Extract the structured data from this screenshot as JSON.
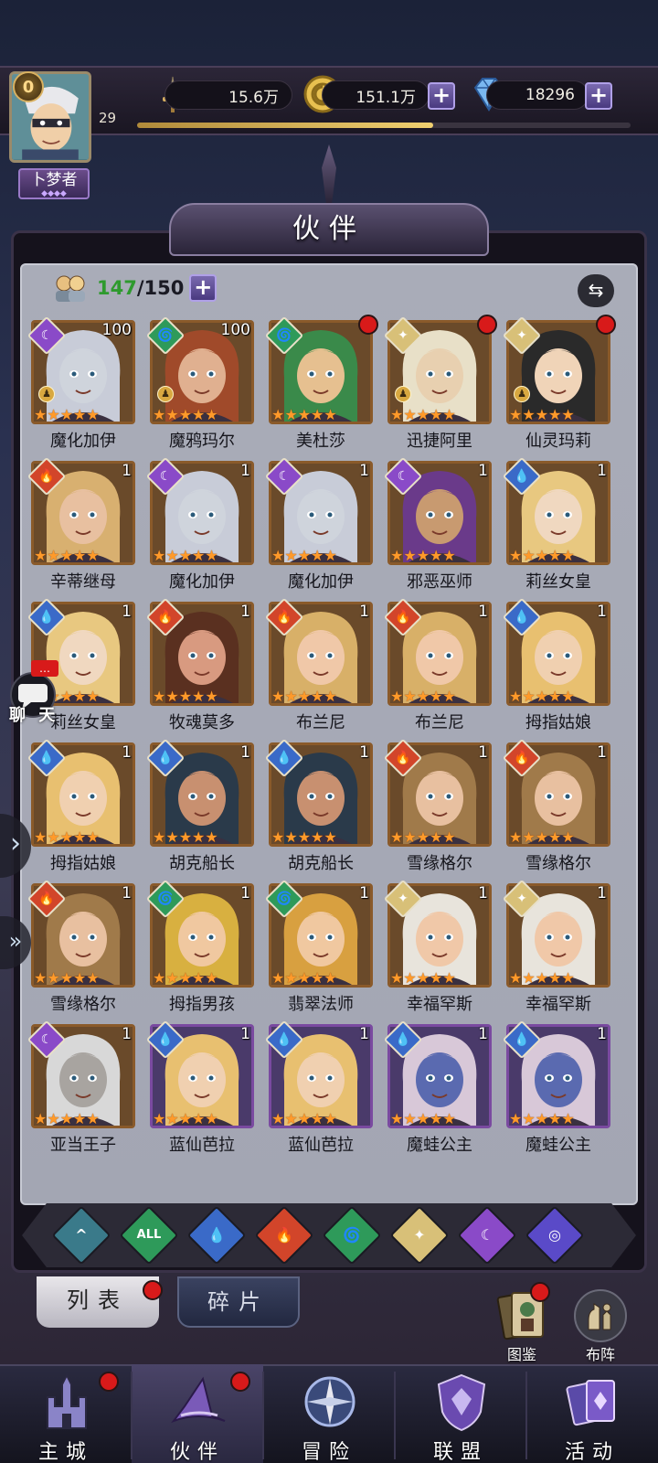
{
  "player": {
    "level": "29",
    "vip": "0",
    "rank": "卜梦者",
    "xp_progress": 0.6
  },
  "resources": {
    "power": "15.6万",
    "gold": "151.1万",
    "gems": "18296"
  },
  "title": "伙伴",
  "roster": {
    "current": "147",
    "max": "/150"
  },
  "chat_label": "聊 天",
  "colors": {
    "fire": "#d2452a",
    "water": "#3a6ac8",
    "wind": "#2e9a5a",
    "light": "#d8c078",
    "dark": "#8a4ac8",
    "void": "#3a7a8a"
  },
  "heroes": [
    {
      "name": "魔化加伊",
      "level": "100",
      "element": "dark",
      "mark": true,
      "red": false,
      "frame": "brown",
      "skin": "#cfd4dc",
      "hair": "#c8ccd8"
    },
    {
      "name": "魔鸦玛尔",
      "level": "100",
      "element": "wind",
      "mark": true,
      "red": false,
      "frame": "brown",
      "skin": "#e0b090",
      "hair": "#a04a2a"
    },
    {
      "name": "美杜莎",
      "level": "",
      "element": "wind",
      "mark": false,
      "red": true,
      "frame": "brown",
      "skin": "#e6c090",
      "hair": "#3a8a4a"
    },
    {
      "name": "迅捷阿里",
      "level": "",
      "element": "light",
      "mark": true,
      "red": true,
      "frame": "brown",
      "skin": "#e8d0b0",
      "hair": "#e8e0c8"
    },
    {
      "name": "仙灵玛莉",
      "level": "",
      "element": "light",
      "mark": true,
      "red": true,
      "frame": "brown",
      "skin": "#f0d4b8",
      "hair": "#2a2a2a"
    },
    {
      "name": "辛蒂继母",
      "level": "1",
      "element": "fire",
      "mark": false,
      "red": false,
      "frame": "brown",
      "skin": "#e8c0a0",
      "hair": "#d8b070"
    },
    {
      "name": "魔化加伊",
      "level": "1",
      "element": "dark",
      "mark": false,
      "red": false,
      "frame": "brown",
      "skin": "#cfd4dc",
      "hair": "#c8ccd8"
    },
    {
      "name": "魔化加伊",
      "level": "1",
      "element": "dark",
      "mark": false,
      "red": false,
      "frame": "brown",
      "skin": "#cfd4dc",
      "hair": "#c8ccd8"
    },
    {
      "name": "邪恶巫师",
      "level": "1",
      "element": "dark",
      "mark": false,
      "red": false,
      "frame": "brown",
      "skin": "#c89a70",
      "hair": "#6a3a8a"
    },
    {
      "name": "莉丝女皇",
      "level": "1",
      "element": "water",
      "mark": false,
      "red": false,
      "frame": "brown",
      "skin": "#f0d8c0",
      "hair": "#e8c880"
    },
    {
      "name": "莉丝女皇",
      "level": "1",
      "element": "water",
      "mark": false,
      "red": false,
      "frame": "brown",
      "skin": "#f0d8c0",
      "hair": "#e8c880"
    },
    {
      "name": "牧魂莫多",
      "level": "1",
      "element": "fire",
      "mark": false,
      "red": false,
      "frame": "brown",
      "skin": "#d89a80",
      "hair": "#5a3020"
    },
    {
      "name": "布兰尼",
      "level": "1",
      "element": "fire",
      "mark": false,
      "red": false,
      "frame": "brown",
      "skin": "#f0c8a8",
      "hair": "#d8b068"
    },
    {
      "name": "布兰尼",
      "level": "1",
      "element": "fire",
      "mark": false,
      "red": false,
      "frame": "brown",
      "skin": "#f0c8a8",
      "hair": "#d8b068"
    },
    {
      "name": "拇指姑娘",
      "level": "1",
      "element": "water",
      "mark": false,
      "red": false,
      "frame": "brown",
      "skin": "#f0d0b0",
      "hair": "#e8c070"
    },
    {
      "name": "拇指姑娘",
      "level": "1",
      "element": "water",
      "mark": false,
      "red": false,
      "frame": "brown",
      "skin": "#f0d0b0",
      "hair": "#e8c070"
    },
    {
      "name": "胡克船长",
      "level": "1",
      "element": "water",
      "mark": false,
      "red": false,
      "frame": "brown",
      "skin": "#c89070",
      "hair": "#2a3a4a"
    },
    {
      "name": "胡克船长",
      "level": "1",
      "element": "water",
      "mark": false,
      "red": false,
      "frame": "brown",
      "skin": "#c89070",
      "hair": "#2a3a4a"
    },
    {
      "name": "雪缘格尔",
      "level": "1",
      "element": "fire",
      "mark": false,
      "red": false,
      "frame": "brown",
      "skin": "#e8c0a0",
      "hair": "#a07a4a"
    },
    {
      "name": "雪缘格尔",
      "level": "1",
      "element": "fire",
      "mark": false,
      "red": false,
      "frame": "brown",
      "skin": "#e8c0a0",
      "hair": "#a07a4a"
    },
    {
      "name": "雪缘格尔",
      "level": "1",
      "element": "fire",
      "mark": false,
      "red": false,
      "frame": "brown",
      "skin": "#e8c0a0",
      "hair": "#a07a4a"
    },
    {
      "name": "拇指男孩",
      "level": "1",
      "element": "wind",
      "mark": false,
      "red": false,
      "frame": "brown",
      "skin": "#f0c8a0",
      "hair": "#d8b040"
    },
    {
      "name": "翡翠法师",
      "level": "1",
      "element": "wind",
      "mark": false,
      "red": false,
      "frame": "brown",
      "skin": "#f0c8a0",
      "hair": "#d8a040"
    },
    {
      "name": "幸福罕斯",
      "level": "1",
      "element": "light",
      "mark": false,
      "red": false,
      "frame": "brown",
      "skin": "#f0c8a8",
      "hair": "#e8e4dc"
    },
    {
      "name": "幸福罕斯",
      "level": "1",
      "element": "light",
      "mark": false,
      "red": false,
      "frame": "brown",
      "skin": "#f0c8a8",
      "hair": "#e8e4dc"
    },
    {
      "name": "亚当王子",
      "level": "1",
      "element": "dark",
      "mark": false,
      "red": false,
      "frame": "brown",
      "skin": "#a8a4a0",
      "hair": "#d8d8d8"
    },
    {
      "name": "蓝仙芭拉",
      "level": "1",
      "element": "water",
      "mark": false,
      "red": false,
      "frame": "purple",
      "skin": "#f0d0b0",
      "hair": "#e8c070"
    },
    {
      "name": "蓝仙芭拉",
      "level": "1",
      "element": "water",
      "mark": false,
      "red": false,
      "frame": "purple",
      "skin": "#f0d0b0",
      "hair": "#e8c070"
    },
    {
      "name": "魔蛙公主",
      "level": "1",
      "element": "water",
      "mark": false,
      "red": false,
      "frame": "purple",
      "skin": "#5a6ab0",
      "hair": "#d8c8d8"
    },
    {
      "name": "魔蛙公主",
      "level": "1",
      "element": "water",
      "mark": false,
      "red": false,
      "frame": "purple",
      "skin": "#5a6ab0",
      "hair": "#d8c8d8"
    }
  ],
  "filters": [
    {
      "id": "void",
      "label": "^"
    },
    {
      "id": "all",
      "label": "ALL"
    },
    {
      "id": "water",
      "label": ""
    },
    {
      "id": "fire",
      "label": ""
    },
    {
      "id": "wind",
      "label": ""
    },
    {
      "id": "light",
      "label": ""
    },
    {
      "id": "dark",
      "label": ""
    },
    {
      "id": "planet",
      "label": ""
    }
  ],
  "tabs": {
    "list": "列表",
    "fragments": "碎片"
  },
  "side_buttons": {
    "codex": "图鉴",
    "formation": "布阵"
  },
  "nav": [
    {
      "label": "主城",
      "icon": "castle-icon",
      "red": true
    },
    {
      "label": "伙伴",
      "icon": "witch-hat-icon",
      "red": true
    },
    {
      "label": "冒险",
      "icon": "compass-icon",
      "red": false
    },
    {
      "label": "联盟",
      "icon": "shield-icon",
      "red": false
    },
    {
      "label": "活动",
      "icon": "cards-icon",
      "red": false
    }
  ]
}
